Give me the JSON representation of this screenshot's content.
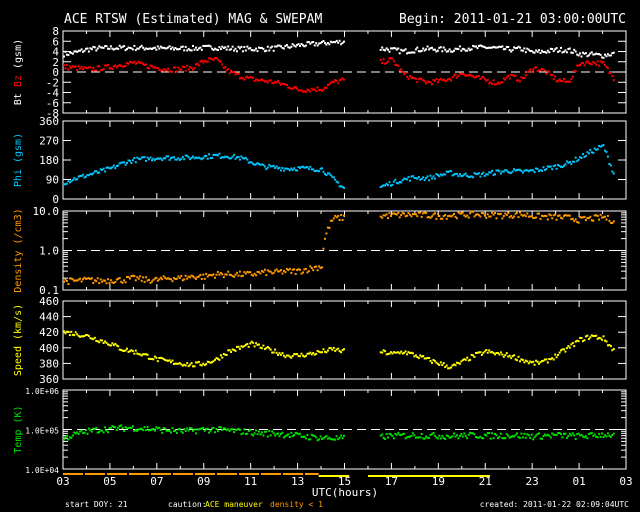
{
  "header": {
    "title": "ACE RTSW (Estimated) MAG & SWEPAM",
    "begin": "Begin: 2011-01-21 03:00:00UTC"
  },
  "footer": {
    "start_doy": "start DOY:  21",
    "caution_label": "caution:",
    "caution_maneuver": "ACE maneuver",
    "caution_density": "density < 1",
    "created": "created: 2011-01-22 02:09:04UTC",
    "xlabel": "UTC(hours)"
  },
  "colors": {
    "bt": "#ffffff",
    "bz": "#ff0000",
    "phi": "#00c8ff",
    "density": "#ff9900",
    "speed": "#ffff00",
    "temp": "#00e000",
    "maneuver": "#ffff00",
    "lowdensity": "#ff9900"
  },
  "chart_data": {
    "type": "scatter",
    "x_hours_from_start": [
      0,
      0.5,
      1,
      1.5,
      2,
      2.5,
      3,
      3.5,
      4,
      4.5,
      5,
      5.5,
      6,
      6.5,
      7,
      7.5,
      8,
      8.5,
      9,
      9.5,
      10,
      10.5,
      11,
      11.5,
      12,
      12.5,
      13,
      13.5,
      14,
      14.5,
      15,
      15.5,
      16,
      16.5,
      17,
      17.5,
      18,
      18.5,
      19,
      19.5,
      20,
      20.5,
      21,
      21.5,
      22,
      22.5,
      23,
      23.5
    ],
    "x_tick_labels": [
      "03",
      "05",
      "07",
      "09",
      "11",
      "13",
      "15",
      "17",
      "19",
      "21",
      "23",
      "01",
      "03"
    ],
    "xlabel": "UTC(hours)",
    "panels": [
      {
        "ylabel_parts": [
          "Bt",
          "Bz",
          "(gsm)"
        ],
        "yticks": [
          "8",
          "6",
          "4",
          "2",
          "0",
          "-2",
          "-4",
          "-6",
          "-8"
        ],
        "ylim": [
          -8,
          8
        ],
        "scale": "linear",
        "ref": 0,
        "series": [
          {
            "name": "Bt",
            "color_key": "bt",
            "values": [
              3.5,
              3.8,
              4.4,
              4.6,
              4.7,
              4.7,
              4.7,
              4.7,
              4.6,
              4.6,
              4.6,
              4.6,
              4.7,
              4.8,
              4.6,
              4.5,
              4.5,
              4.5,
              4.6,
              4.9,
              5.2,
              5.4,
              5.6,
              5.8,
              5.9,
              null,
              null,
              4.6,
              4.3,
              4.0,
              4.3,
              4.5,
              4.4,
              4.3,
              4.6,
              4.7,
              4.8,
              4.6,
              4.4,
              4.5,
              3.8,
              4.0,
              4.3,
              4.3,
              3.5,
              3.4,
              3.2,
              3.7
            ]
          },
          {
            "name": "Bz",
            "color_key": "bz",
            "values": [
              1.0,
              0.8,
              0.5,
              0.7,
              1.0,
              1.5,
              1.8,
              1.2,
              0.8,
              0.5,
              0.6,
              0.9,
              2.2,
              2.4,
              0.2,
              -0.8,
              -1.4,
              -1.7,
              -2.0,
              -2.6,
              -3.5,
              -3.4,
              -3.3,
              -2.0,
              -1.5,
              null,
              null,
              1.9,
              2.4,
              -0.5,
              -1.5,
              -2.0,
              -1.8,
              -1.2,
              -0.2,
              -1.0,
              -1.6,
              -2.2,
              -0.8,
              -1.5,
              0.8,
              0.2,
              -1.5,
              -2.0,
              1.7,
              1.9,
              1.6,
              -1.5
            ]
          }
        ]
      },
      {
        "ylabel_parts": [
          "Phi",
          "(gsm)"
        ],
        "yticks": [
          "360",
          "270",
          "180",
          "90",
          "0"
        ],
        "ylim": [
          0,
          360
        ],
        "scale": "linear",
        "ref": null,
        "series": [
          {
            "name": "Phi",
            "color_key": "phi",
            "values": [
              75,
              95,
              110,
              125,
              140,
              165,
              180,
              185,
              190,
              190,
              190,
              192,
              195,
              200,
              198,
              190,
              170,
              150,
              145,
              140,
              142,
              140,
              138,
              90,
              45,
              null,
              null,
              55,
              75,
              90,
              100,
              95,
              110,
              120,
              110,
              110,
              115,
              125,
              130,
              125,
              130,
              140,
              150,
              165,
              190,
              220,
              245,
              100
            ]
          }
        ]
      },
      {
        "ylabel_parts": [
          "Density",
          "(/cm3)"
        ],
        "yticks": [
          "10.0",
          "1.0",
          "0.1"
        ],
        "ylim": [
          0.1,
          10
        ],
        "scale": "log",
        "ref": 1,
        "series": [
          {
            "name": "Density",
            "color_key": "density",
            "values": [
              0.17,
              0.17,
              0.18,
              0.17,
              0.18,
              0.18,
              0.2,
              0.18,
              0.18,
              0.2,
              0.2,
              0.22,
              0.22,
              0.25,
              0.25,
              0.25,
              0.25,
              0.28,
              0.28,
              0.3,
              0.3,
              0.35,
              0.4,
              6.5,
              7.0,
              null,
              null,
              7.5,
              7.8,
              8.0,
              8.0,
              7.8,
              7.5,
              7.8,
              8.0,
              8.2,
              8.0,
              7.8,
              8.0,
              8.2,
              7.5,
              7.2,
              7.0,
              6.8,
              6.0,
              6.5,
              7.0,
              5.5
            ]
          }
        ]
      },
      {
        "ylabel_parts": [
          "Speed",
          "(km/s)"
        ],
        "yticks": [
          "460",
          "440",
          "420",
          "400",
          "380",
          "360"
        ],
        "ylim": [
          360,
          460
        ],
        "scale": "linear",
        "ref": null,
        "series": [
          {
            "name": "Speed",
            "color_key": "speed",
            "values": [
              420,
              418,
              415,
              410,
              405,
              398,
              395,
              390,
              385,
              382,
              380,
              378,
              380,
              385,
              395,
              400,
              405,
              400,
              395,
              390,
              390,
              392,
              395,
              398,
              395,
              null,
              null,
              395,
              392,
              395,
              390,
              385,
              380,
              375,
              382,
              390,
              395,
              392,
              390,
              385,
              380,
              382,
              390,
              400,
              410,
              415,
              412,
              395
            ]
          }
        ]
      },
      {
        "ylabel_parts": [
          "Temp",
          "(K)"
        ],
        "yticks": [
          "1.0E+06",
          "1.0E+05",
          "1.0E+04"
        ],
        "ylim": [
          10000,
          1000000
        ],
        "scale": "log",
        "ref": 100000,
        "series": [
          {
            "name": "Temp",
            "color_key": "temp",
            "values": [
              60000,
              75000,
              90000,
              100000,
              105000,
              110000,
              110000,
              105000,
              100000,
              95000,
              90000,
              95000,
              100000,
              100000,
              95000,
              90000,
              85000,
              80000,
              80000,
              75000,
              70000,
              65000,
              62000,
              60000,
              60000,
              null,
              null,
              65000,
              70000,
              70000,
              72000,
              70000,
              70000,
              68000,
              70000,
              72000,
              70000,
              70000,
              72000,
              70000,
              68000,
              70000,
              72000,
              70000,
              68000,
              70000,
              75000,
              72000
            ]
          }
        ]
      }
    ],
    "flag_bars": [
      {
        "name": "density < 1",
        "color_key": "lowdensity",
        "start_hour": 0,
        "end_hour": 10.9
      },
      {
        "name": "ACE maneuver",
        "color_key": "maneuver",
        "start_hour": 10.9,
        "end_hour": 12.2
      },
      {
        "name": "ACE maneuver",
        "color_key": "maneuver",
        "start_hour": 13.0,
        "end_hour": 18.2
      }
    ]
  }
}
